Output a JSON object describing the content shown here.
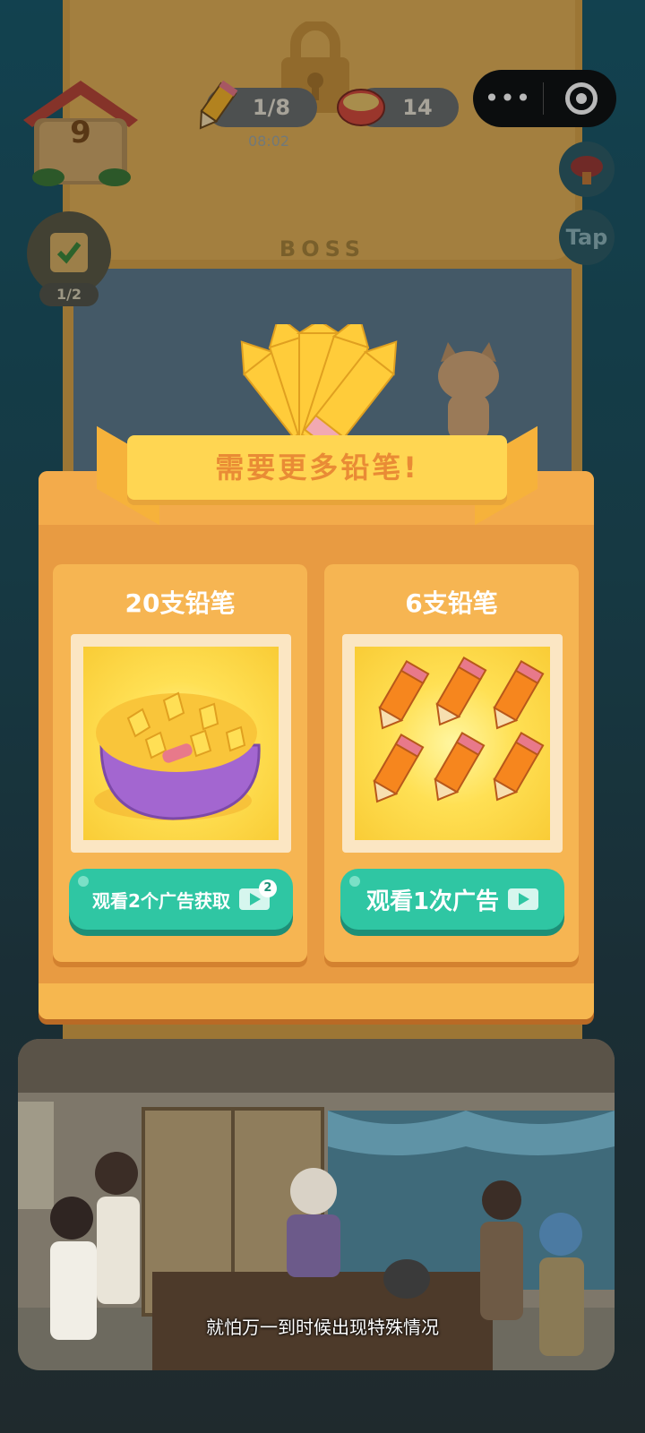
{
  "hud": {
    "level": "9",
    "pencil_count": "1/8",
    "timer": "08:02",
    "coin_count": "14",
    "task_progress": "1/2",
    "boss_label": "BOSS",
    "tap_label": "Tap"
  },
  "dialog": {
    "title": "需要更多铅笔!",
    "offers": [
      {
        "title": "20支铅笔",
        "button_label": "观看2个广告获取",
        "ad_count_badge": "2"
      },
      {
        "title": "6支铅笔",
        "button_label": "观看1次广告"
      }
    ]
  },
  "cutscene": {
    "subtitle": "就怕万一到时候出现特殊情况"
  },
  "colors": {
    "accent_green": "#2fc6a3",
    "panel_orange": "#e89b42",
    "ribbon_yellow": "#ffd652",
    "title_orange": "#e98b35"
  }
}
